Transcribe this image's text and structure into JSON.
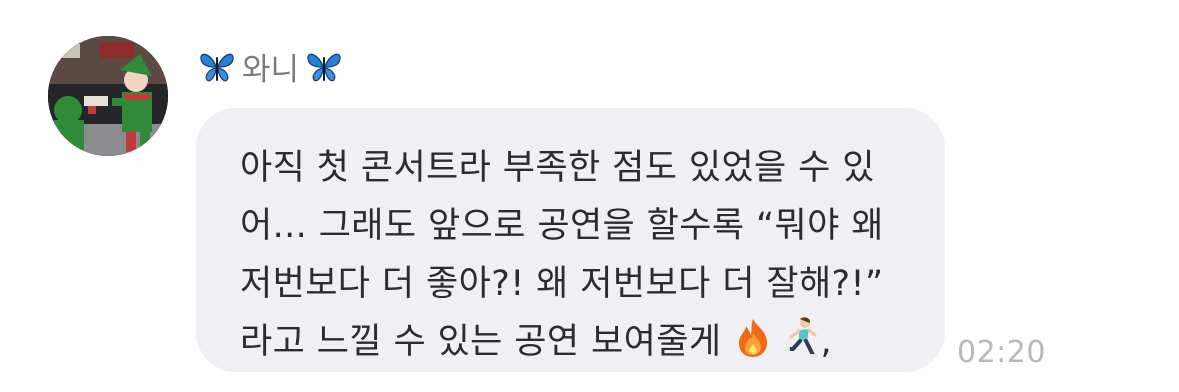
{
  "sender": {
    "name": "와니",
    "avatar_icon": "profile-photo-elf-costume"
  },
  "message": {
    "lines": [
      "아직 첫 콘서트라 부족한 점도 있었을 수 있",
      "어... 그래도 앞으로 공연을 할수록 “뭐야 왜",
      "저번보다 더 좋아?! 왜 저번보다 더 잘해?!”",
      "라고 느낄 수 있는 공연 보여줄게"
    ],
    "trailing_punctuation": ",",
    "emojis": [
      "fire-icon",
      "runner-icon"
    ]
  },
  "timestamp": "02:20",
  "colors": {
    "bubble": "#f0f0f4",
    "text": "#2c2c2e",
    "sender_name": "#7a7a7f",
    "timestamp": "#b8b8bd",
    "butterfly": "#2a7fd6"
  }
}
